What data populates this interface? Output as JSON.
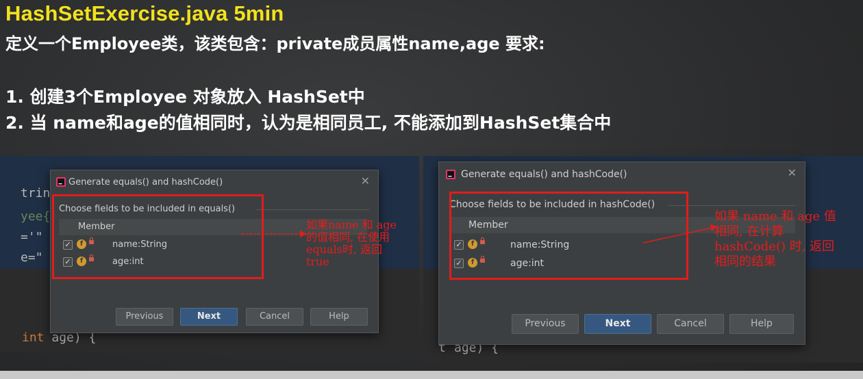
{
  "slide": {
    "title": "HashSetExercise.java 5min",
    "line1": "定义一个Employee类，该类包含：private成员属性name,age 要求:",
    "line2": "1. 创建3个Employee 对象放入 HashSet中",
    "line3": "2. 当 name和age的值相同时，认为是相同员工, 不能添加到HashSet集合中"
  },
  "code_left": {
    "frag1": "tring",
    "frag2": "yee{",
    "frag3": "='\"",
    "frag4": "e=\"",
    "frag5_kw": "int",
    "frag5_rest": " age) {"
  },
  "code_right": {
    "frag1": "t",
    "frag2": "age) {"
  },
  "dialog_left": {
    "title": "Generate equals() and hashCode()",
    "section": "Choose fields to be included in equals()",
    "column": "Member",
    "rows": [
      "name:String",
      "age:int"
    ],
    "buttons": {
      "previous": "Previous",
      "next": "Next",
      "cancel": "Cancel",
      "help": "Help"
    }
  },
  "dialog_right": {
    "title": "Generate equals() and hashCode()",
    "section": "Choose fields to be included in hashCode()",
    "column": "Member",
    "rows": [
      "name:String",
      "age:int"
    ],
    "buttons": {
      "previous": "Previous",
      "next": "Next",
      "cancel": "Cancel",
      "help": "Help"
    }
  },
  "annotations": {
    "left": [
      "如果name 和 age",
      "的值相同, 在使用",
      "equals时, 返回",
      "true"
    ],
    "right": [
      "如果 name 和 age 值",
      "相同, 在计算",
      "hashCode() 时, 返回",
      "相同的结果"
    ]
  },
  "colors": {
    "title": "#f2e21d",
    "highlight": "#e21c1c",
    "primary_button": "#365880"
  }
}
